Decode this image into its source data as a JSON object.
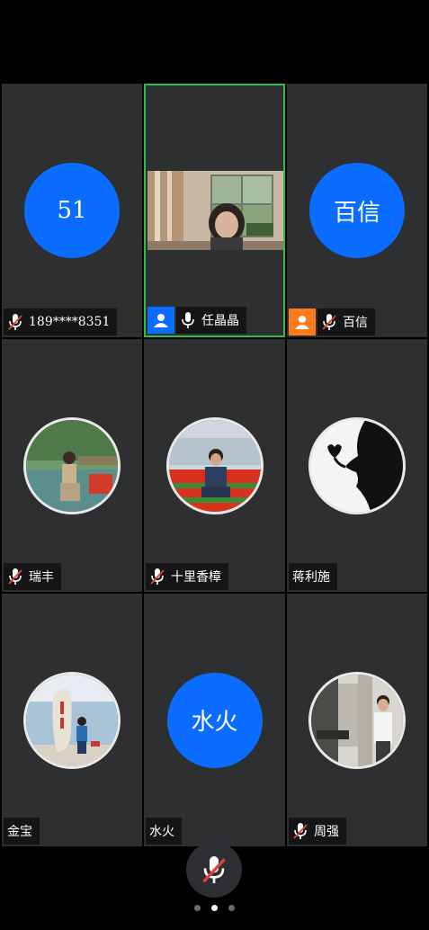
{
  "participants": [
    {
      "name": "189****8351",
      "avatar_text": "51",
      "avatar_type": "text",
      "muted": true
    },
    {
      "name": "任晶晶",
      "avatar_type": "video",
      "muted": false,
      "active": true,
      "role": "user-icon",
      "role_color": "#0a6dff"
    },
    {
      "name": "百信",
      "avatar_text": "百信",
      "avatar_type": "text",
      "muted": true,
      "role": "user-icon",
      "role_color": "#ff7a1a"
    },
    {
      "name": "瑞丰",
      "avatar_type": "photo",
      "muted": true
    },
    {
      "name": "十里香樟",
      "avatar_type": "photo",
      "muted": true
    },
    {
      "name": "蒋利施",
      "avatar_type": "photo",
      "muted": false
    },
    {
      "name": "金宝",
      "avatar_type": "photo",
      "muted": false
    },
    {
      "name": "水火",
      "avatar_text": "水火",
      "avatar_type": "text",
      "muted": false
    },
    {
      "name": "周强",
      "avatar_type": "photo",
      "muted": true
    }
  ],
  "colors": {
    "accent": "#0a6dff",
    "active_border": "#2bbf4a",
    "host_badge": "#ff7a1a",
    "muted_slash": "#e0413a"
  },
  "pager": {
    "pages": 3,
    "current": 2
  },
  "bottom_bar": {
    "mic_state": "muted"
  }
}
